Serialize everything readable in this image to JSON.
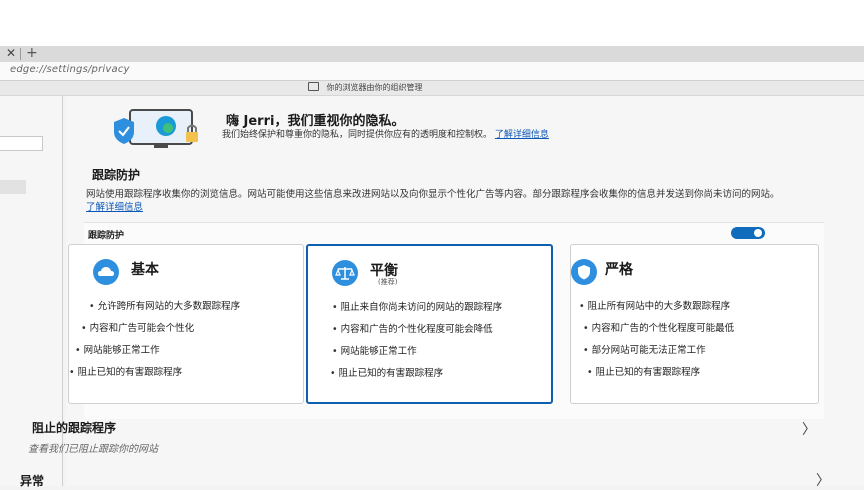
{
  "browser": {
    "tab_close": "✕",
    "new_tab": "+",
    "url": "edge://settings/privacy",
    "managed_notice": "你的浏览器由你的组织管理"
  },
  "hero": {
    "title": "嗨 Jerri，我们重视你的隐私。",
    "description": "我们始终保护和尊重你的隐私，同时提供你应有的透明度和控制权。",
    "link": "了解详细信息"
  },
  "tracking": {
    "title": "跟踪防护",
    "description": "网站使用跟踪程序收集你的浏览信息。网站可能使用这些信息来改进网站以及向你显示个性化广告等内容。部分跟踪程序会收集你的信息并发送到你尚未访问的网站。",
    "link": "了解详细信息",
    "panel_title": "跟踪防护",
    "toggle_on": true,
    "cards": {
      "basic": {
        "title": "基本",
        "items": [
          "允许跨所有网站的大多数跟踪程序",
          "内容和广告可能会个性化",
          "网站能够正常工作",
          "阻止已知的有害跟踪程序"
        ]
      },
      "balanced": {
        "title": "平衡",
        "subtitle": "(推荐)",
        "items": [
          "阻止来自你尚未访问的网站的跟踪程序",
          "内容和广告的个性化程度可能会降低",
          "网站能够正常工作",
          "阻止已知的有害跟踪程序"
        ]
      },
      "strict": {
        "title": "严格",
        "items": [
          "阻止所有网站中的大多数跟踪程序",
          "内容和广告的个性化程度可能最低",
          "部分网站可能无法正常工作",
          "阻止已知的有害跟踪程序"
        ]
      }
    }
  },
  "blocked": {
    "title": "阻止的跟踪程序",
    "subtitle": "查看我们已阻止跟踪你的网站"
  },
  "exceptions": {
    "title": "异常"
  },
  "colors": {
    "accent": "#0f6cbd",
    "selected_border": "#0f5fb0",
    "link": "#0b57b8"
  }
}
